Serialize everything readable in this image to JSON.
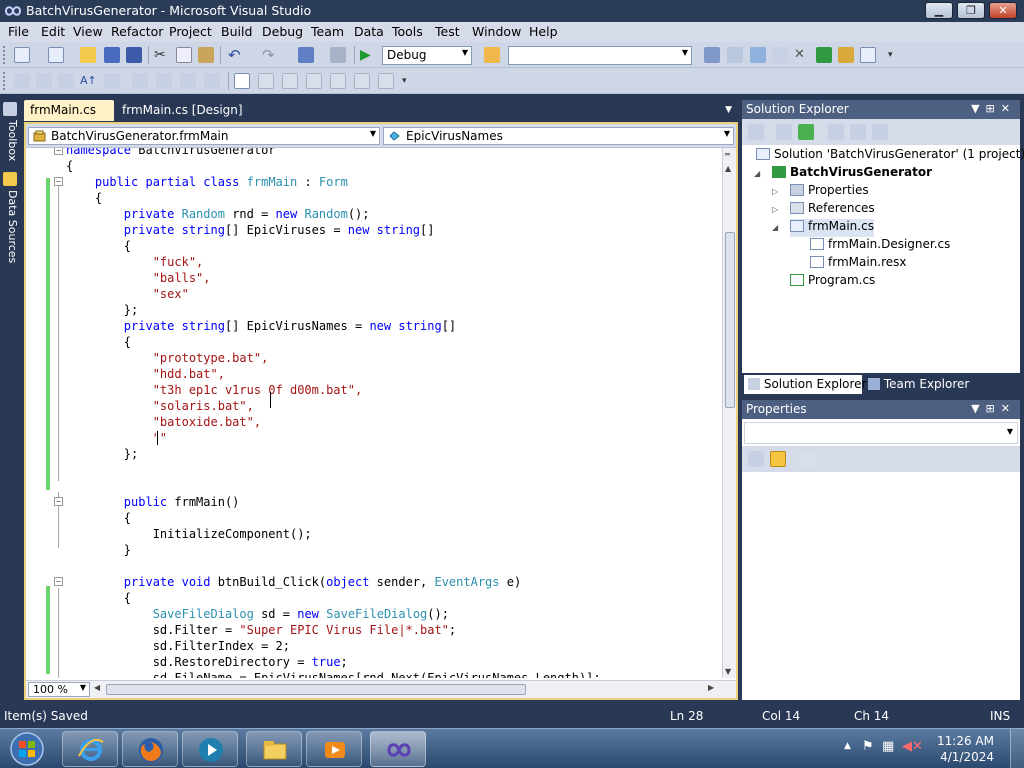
{
  "window": {
    "title": "BatchVirusGenerator - Microsoft Visual Studio",
    "minimize": "▁",
    "maximize": "❐",
    "close": "✕"
  },
  "menu": [
    "File",
    "Edit",
    "View",
    "Refactor",
    "Project",
    "Build",
    "Debug",
    "Team",
    "Data",
    "Tools",
    "Test",
    "Window",
    "Help"
  ],
  "toolbar": {
    "configuration": "Debug",
    "platform": ""
  },
  "left_dock": [
    "Toolbox",
    "Data Sources"
  ],
  "doc_tabs": {
    "active": "frmMain.cs",
    "design": "frmMain.cs [Design]"
  },
  "navigation": {
    "class_combo": "BatchVirusGenerator.frmMain",
    "member_combo": "EpicVirusNames"
  },
  "code_lines": [
    "namespace BatchVirusGenerator",
    "{",
    "    public partial class frmMain : Form",
    "    {",
    "        private Random rnd = new Random();",
    "        private string[] EpicViruses = new string[]",
    "        {",
    "            \"fuck\",",
    "            \"balls\",",
    "            \"sex\"",
    "        };",
    "        private string[] EpicVirusNames = new string[]",
    "        {",
    "            \"prototype.bat\",",
    "            \"hdd.bat\",",
    "            \"t3h ep1c v1rus 0f d00m.bat\",",
    "            \"solaris.bat\",",
    "            \"batoxide.bat\",",
    "            \"\"",
    "        };",
    "",
    "",
    "        public frmMain()",
    "        {",
    "            InitializeComponent();",
    "        }",
    "",
    "        private void btnBuild_Click(object sender, EventArgs e)",
    "        {",
    "            SaveFileDialog sd = new SaveFileDialog();",
    "            sd.Filter = \"Super EPIC Virus File|*.bat\";",
    "            sd.FilterIndex = 2;",
    "            sd.RestoreDirectory = true;",
    "            sd.FileName = EpicVirusNames[rnd.Next(EpicVirusNames.Length)];"
  ],
  "editor": {
    "zoom": "100 %"
  },
  "solution_explorer": {
    "title": "Solution Explorer",
    "tree": [
      {
        "label": "Solution 'BatchVirusGenerator' (1 project)",
        "bold": false
      },
      {
        "label": "BatchVirusGenerator",
        "bold": true
      },
      {
        "label": "Properties",
        "bold": false
      },
      {
        "label": "References",
        "bold": false
      },
      {
        "label": "frmMain.cs",
        "bold": false
      },
      {
        "label": "frmMain.Designer.cs",
        "bold": false
      },
      {
        "label": "frmMain.resx",
        "bold": false
      },
      {
        "label": "Program.cs",
        "bold": false
      }
    ],
    "tabs": [
      "Solution Explorer",
      "Team Explorer"
    ]
  },
  "properties": {
    "title": "Properties"
  },
  "status": {
    "message": "Item(s) Saved",
    "line": "Ln 28",
    "col": "Col 14",
    "ch": "Ch 14",
    "mode": "INS"
  },
  "taskbar": {
    "time": "11:26 AM",
    "date": "4/1/2024"
  },
  "colors": {
    "accent": "#293955",
    "active_tab": "#fff2c6",
    "keyword": "#0000ff",
    "type": "#2b91af",
    "string": "#a31515",
    "changed_margin": "#6bd46b"
  }
}
